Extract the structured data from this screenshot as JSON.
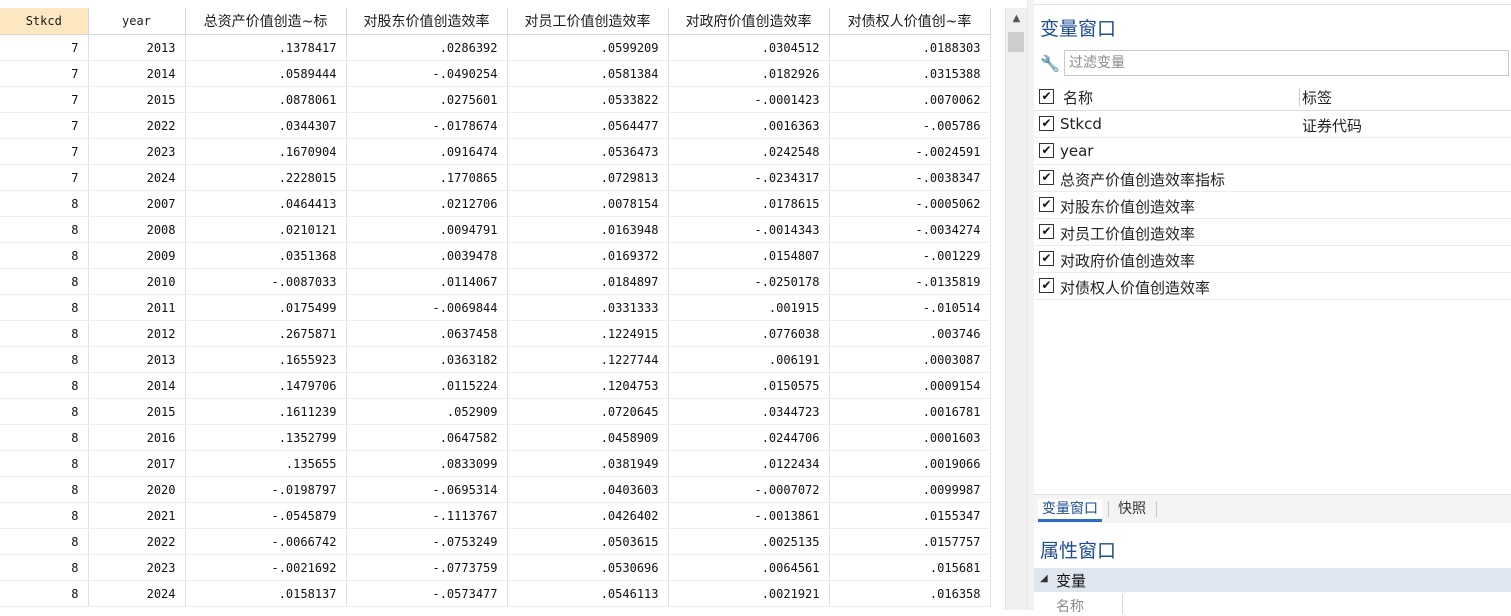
{
  "grid": {
    "columns": [
      "Stkcd",
      "year",
      "总资产价值创造~标",
      "对股东价值创造效率",
      "对员工价值创造效率",
      "对政府价值创造效率",
      "对债权人价值创~率"
    ],
    "rows": [
      [
        "7",
        "2013",
        ".1378417",
        ".0286392",
        ".0599209",
        ".0304512",
        ".0188303"
      ],
      [
        "7",
        "2014",
        ".0589444",
        "-.0490254",
        ".0581384",
        ".0182926",
        ".0315388"
      ],
      [
        "7",
        "2015",
        ".0878061",
        ".0275601",
        ".0533822",
        "-.0001423",
        ".0070062"
      ],
      [
        "7",
        "2022",
        ".0344307",
        "-.0178674",
        ".0564477",
        ".0016363",
        "-.005786"
      ],
      [
        "7",
        "2023",
        ".1670904",
        ".0916474",
        ".0536473",
        ".0242548",
        "-.0024591"
      ],
      [
        "7",
        "2024",
        ".2228015",
        ".1770865",
        ".0729813",
        "-.0234317",
        "-.0038347"
      ],
      [
        "8",
        "2007",
        ".0464413",
        ".0212706",
        ".0078154",
        ".0178615",
        "-.0005062"
      ],
      [
        "8",
        "2008",
        ".0210121",
        ".0094791",
        ".0163948",
        "-.0014343",
        "-.0034274"
      ],
      [
        "8",
        "2009",
        ".0351368",
        ".0039478",
        ".0169372",
        ".0154807",
        "-.001229"
      ],
      [
        "8",
        "2010",
        "-.0087033",
        ".0114067",
        ".0184897",
        "-.0250178",
        "-.0135819"
      ],
      [
        "8",
        "2011",
        ".0175499",
        "-.0069844",
        ".0331333",
        ".001915",
        "-.010514"
      ],
      [
        "8",
        "2012",
        ".2675871",
        ".0637458",
        ".1224915",
        ".0776038",
        ".003746"
      ],
      [
        "8",
        "2013",
        ".1655923",
        ".0363182",
        ".1227744",
        ".006191",
        ".0003087"
      ],
      [
        "8",
        "2014",
        ".1479706",
        ".0115224",
        ".1204753",
        ".0150575",
        ".0009154"
      ],
      [
        "8",
        "2015",
        ".1611239",
        ".052909",
        ".0720645",
        ".0344723",
        ".0016781"
      ],
      [
        "8",
        "2016",
        ".1352799",
        ".0647582",
        ".0458909",
        ".0244706",
        ".0001603"
      ],
      [
        "8",
        "2017",
        ".135655",
        ".0833099",
        ".0381949",
        ".0122434",
        ".0019066"
      ],
      [
        "8",
        "2020",
        "-.0198797",
        "-.0695314",
        ".0403603",
        "-.0007072",
        ".0099987"
      ],
      [
        "8",
        "2021",
        "-.0545879",
        "-.1113767",
        ".0426402",
        "-.0013861",
        ".0155347"
      ],
      [
        "8",
        "2022",
        "-.0066742",
        "-.0753249",
        ".0503615",
        ".0025135",
        ".0157757"
      ],
      [
        "8",
        "2023",
        "-.0021692",
        "-.0773759",
        ".0530696",
        ".0064561",
        ".015681"
      ],
      [
        "8",
        "2024",
        ".0158137",
        "-.0573477",
        ".0546113",
        ".0021921",
        ".016358"
      ]
    ]
  },
  "variables_window": {
    "title": "变量窗口",
    "filter_placeholder": "过滤变量",
    "header": {
      "name": "名称",
      "label": "标签"
    },
    "items": [
      {
        "name": "Stkcd",
        "label": "证券代码"
      },
      {
        "name": "year",
        "label": ""
      },
      {
        "name": "总资产价值创造效率指标",
        "label": ""
      },
      {
        "name": "对股东价值创造效率",
        "label": ""
      },
      {
        "name": "对员工价值创造效率",
        "label": ""
      },
      {
        "name": "对政府价值创造效率",
        "label": ""
      },
      {
        "name": "对债权人价值创造效率",
        "label": ""
      }
    ]
  },
  "tabs": [
    {
      "label": "变量窗口",
      "active": true
    },
    {
      "label": "快照",
      "active": false
    }
  ],
  "properties_window": {
    "title": "属性窗口",
    "group": "变量",
    "first_field": "名称"
  },
  "icons": {
    "filter": "wrench-icon",
    "scroll_up": "chevron-up-icon",
    "checkbox": "check-icon",
    "expand": "triangle-down-icon"
  },
  "colors": {
    "selected_header": "#fde7c0",
    "panel_title": "#1f4e96",
    "active_tab": "#2b6cc4",
    "group_bg": "#dfe6f0"
  }
}
